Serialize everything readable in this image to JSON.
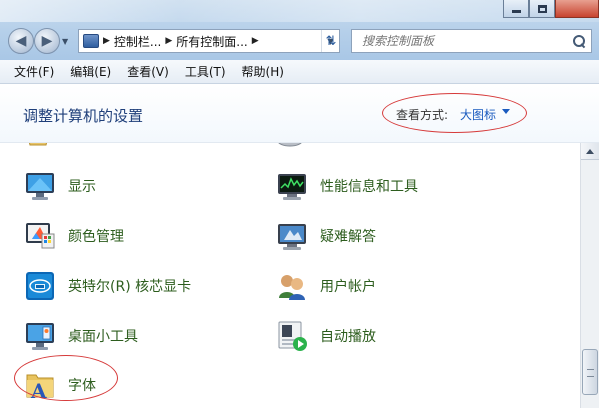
{
  "nav": {
    "breadcrumbs": [
      "控制栏...",
      "所有控制面..."
    ],
    "search_placeholder": "搜索控制面板"
  },
  "menu": [
    "文件(F)",
    "编辑(E)",
    "查看(V)",
    "工具(T)",
    "帮助(H)"
  ],
  "header": {
    "title": "调整计算机的设置",
    "view_label": "查看方式:",
    "view_value": "大图标"
  },
  "items": [
    {
      "label": "显示",
      "icon": "display-icon"
    },
    {
      "label": "性能信息和工具",
      "icon": "performance-icon"
    },
    {
      "label": "颜色管理",
      "icon": "color-management-icon"
    },
    {
      "label": "疑难解答",
      "icon": "troubleshooting-icon"
    },
    {
      "label": "英特尔(R) 核芯显卡",
      "icon": "intel-graphics-icon"
    },
    {
      "label": "用户帐户",
      "icon": "user-accounts-icon"
    },
    {
      "label": "桌面小工具",
      "icon": "desktop-gadgets-icon"
    },
    {
      "label": "自动播放",
      "icon": "autoplay-icon"
    },
    {
      "label": "字体",
      "icon": "fonts-icon"
    }
  ],
  "colors": {
    "label_green": "#2d5d1e",
    "title_blue": "#1f3f7a",
    "link_blue": "#1a5bbf",
    "annotation_red": "#d63a3a"
  }
}
